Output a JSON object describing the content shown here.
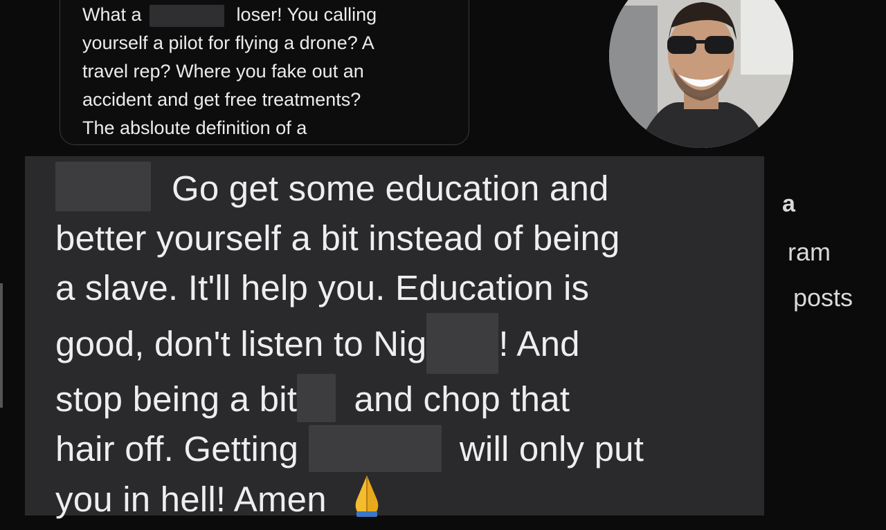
{
  "top_message": {
    "lines": [
      [
        "What a ",
        " loser!  You calling"
      ],
      "yourself a pilot for flying a drone? A",
      "travel rep? Where you fake out an",
      "accident and get free treatments?",
      "The absloute definition of a"
    ]
  },
  "profile": {
    "name_fragment": "a",
    "line2_fragment": "ram",
    "posts_fragment": "posts"
  },
  "main_message": {
    "line1": "Go get some education and",
    "line2": "better yourself a bit instead of being",
    "line3": "a slave. It'll help you. Education is",
    "line4_a": "good, don't listen to Nig",
    "line4_b": "! And",
    "line5_a": "stop being a bit",
    "line5_b": " and chop that",
    "line6_a": "hair off. Getting ",
    "line6_b": " will only put",
    "line7": "you in hell!  Amen",
    "emoji_icon": "folded-hands-icon"
  },
  "colors": {
    "background": "#0b0b0c",
    "main_bubble": "#2a2a2d",
    "redaction": "#3d3d40"
  }
}
